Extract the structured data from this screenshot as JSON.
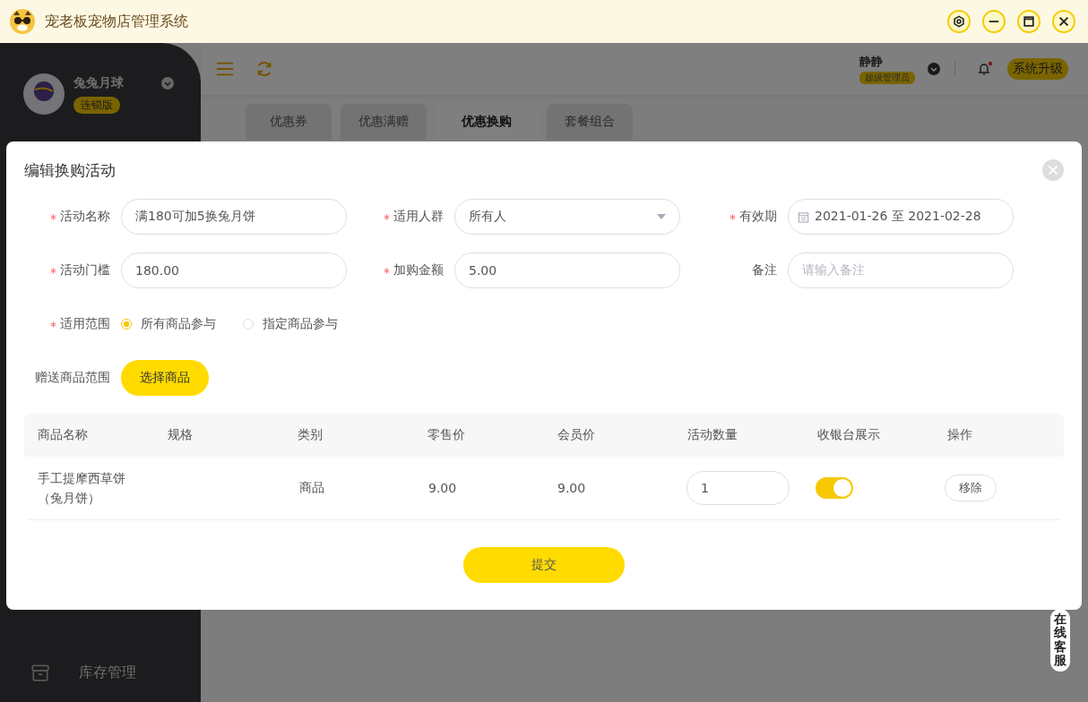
{
  "window": {
    "title": "宠老板宠物店管理系统"
  },
  "sidebar": {
    "store_name": "兔兔月球",
    "edition": "连锁版",
    "items": [
      {
        "label": "库存管理"
      }
    ]
  },
  "topbar": {
    "user": "静静",
    "role": "超级管理员",
    "notification_dot": true,
    "upgrade": "系统升级"
  },
  "tabs": [
    {
      "label": "优惠券",
      "selected": false
    },
    {
      "label": "优惠满赠",
      "selected": false
    },
    {
      "label": "优惠换购",
      "selected": true
    },
    {
      "label": "套餐组合",
      "selected": false
    }
  ],
  "dialog": {
    "title": "编辑换购活动",
    "fields": [
      {
        "label": "活动名称",
        "required": true,
        "kind": "text",
        "value": "满180可加5换兔月饼"
      },
      {
        "label": "适用人群",
        "required": true,
        "kind": "select",
        "value": "所有人"
      },
      {
        "label": "有效期",
        "required": true,
        "kind": "date",
        "value": "2021-01-26 至 2021-02-28"
      },
      {
        "label": "活动门槛",
        "required": true,
        "kind": "text",
        "value": "180.00"
      },
      {
        "label": "加购金额",
        "required": true,
        "kind": "text",
        "value": "5.00"
      },
      {
        "label": "备注",
        "required": false,
        "kind": "text",
        "placeholder": "请输入备注"
      }
    ],
    "scope": {
      "label": "适用范围",
      "required": true,
      "options": [
        {
          "label": "所有商品参与",
          "selected": true
        },
        {
          "label": "指定商品参与",
          "selected": false
        }
      ]
    },
    "gift": {
      "label": "赠送商品范围",
      "button": "选择商品"
    },
    "table": {
      "columns": [
        "商品名称",
        "规格",
        "类别",
        "零售价",
        "会员价",
        "活动数量",
        "收银台展示",
        "操作"
      ],
      "rows": [
        {
          "name": "手工提摩西草饼（兔月饼）",
          "category": "商品",
          "retail_price": "9.00",
          "member_price": "9.00",
          "quantity": "1",
          "cashier_display": true,
          "action": "移除"
        }
      ]
    },
    "submit": "提交"
  },
  "support": "在线客服"
}
